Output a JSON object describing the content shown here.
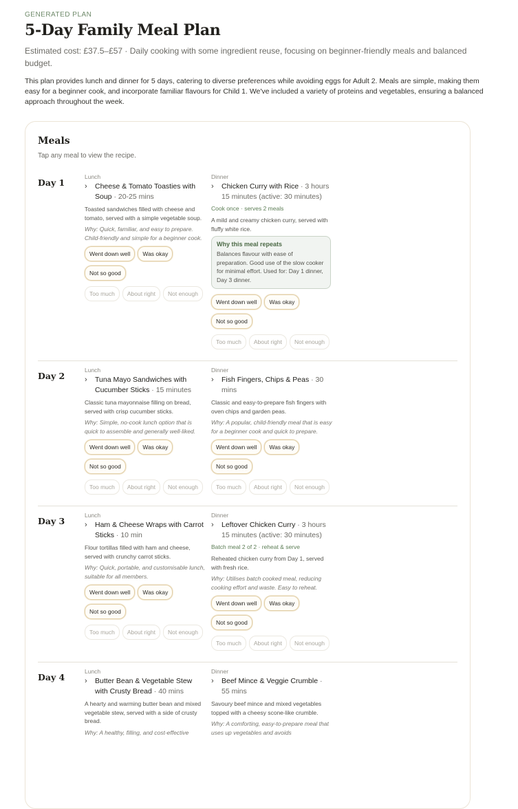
{
  "header": {
    "eyebrow": "GENERATED PLAN",
    "title": "5-Day Family Meal Plan",
    "subtitle": "Estimated cost: £37.5–£57 · Daily cooking with some ingredient reuse, focusing on beginner-friendly meals and balanced budget.",
    "intro": "This plan provides lunch and dinner for 5 days, catering to diverse preferences while avoiding eggs for Adult 2. Meals are simple, making them easy for a beginner cook, and incorporate familiar flavours for Child 1. We've included a variety of proteins and vegetables, ensuring a balanced approach throughout the week."
  },
  "meals_card": {
    "title": "Meals",
    "hint": "Tap any meal to view the recipe."
  },
  "labels": {
    "lunch": "Lunch",
    "dinner": "Dinner",
    "repeat_title": "Why this meal repeats",
    "feedback": [
      "Went down well",
      "Was okay",
      "Not so good"
    ],
    "portion": [
      "Too much",
      "About right",
      "Not enough"
    ]
  },
  "days": [
    {
      "label": "Day 1",
      "lunch": {
        "name": "Cheese & Tomato Toasties with Soup",
        "time": " · 20-25 mins",
        "desc": "Toasted sandwiches filled with cheese and tomato, served with a simple vegetable soup.",
        "why": "Why: Quick, familiar, and easy to prepare. Child-friendly and simple for a beginner cook."
      },
      "dinner": {
        "name": "Chicken Curry with Rice",
        "time": " · 3 hours 15 minutes (active: 30 minutes)",
        "batch": "Cook once · serves 2 meals",
        "desc": "A mild and creamy chicken curry, served with fluffy white rice.",
        "repeat_text": "Balances flavour with ease of preparation. Good use of the slow cooker for minimal effort. Used for: Day 1 dinner, Day 3 dinner."
      }
    },
    {
      "label": "Day 2",
      "lunch": {
        "name": "Tuna Mayo Sandwiches with Cucumber Sticks",
        "time": " · 15 minutes",
        "desc": "Classic tuna mayonnaise filling on bread, served with crisp cucumber sticks.",
        "why": "Why: Simple, no-cook lunch option that is quick to assemble and generally well-liked."
      },
      "dinner": {
        "name": "Fish Fingers, Chips & Peas",
        "time": " · 30 mins",
        "desc": "Classic and easy-to-prepare fish fingers with oven chips and garden peas.",
        "why": "Why: A popular, child-friendly meal that is easy for a beginner cook and quick to prepare."
      }
    },
    {
      "label": "Day 3",
      "lunch": {
        "name": "Ham & Cheese Wraps with Carrot Sticks",
        "time": " · 10 min",
        "desc": "Flour tortillas filled with ham and cheese, served with crunchy carrot sticks.",
        "why": "Why: Quick, portable, and customisable lunch, suitable for all members."
      },
      "dinner": {
        "name": "Leftover Chicken Curry",
        "time": " · 3 hours 15 minutes (active: 30 minutes)",
        "batch": "Batch meal 2 of 2 · reheat & serve",
        "desc": "Reheated chicken curry from Day 1, served with fresh rice.",
        "why": "Why: Utilises batch cooked meal, reducing cooking effort and waste. Easy to reheat."
      }
    },
    {
      "label": "Day 4",
      "lunch": {
        "name": "Butter Bean & Vegetable Stew with Crusty Bread",
        "time": " · 40 mins",
        "desc": "A hearty and warming butter bean and mixed vegetable stew, served with a side of crusty bread.",
        "why": "Why: A healthy, filling, and cost-effective"
      },
      "dinner": {
        "name": "Beef Mince & Veggie Crumble",
        "time": " · 55 mins",
        "desc": "Savoury beef mince and mixed vegetables topped with a cheesy scone-like crumble.",
        "why": "Why: A comforting, easy-to-prepare meal that uses up vegetables and avoids"
      }
    }
  ]
}
